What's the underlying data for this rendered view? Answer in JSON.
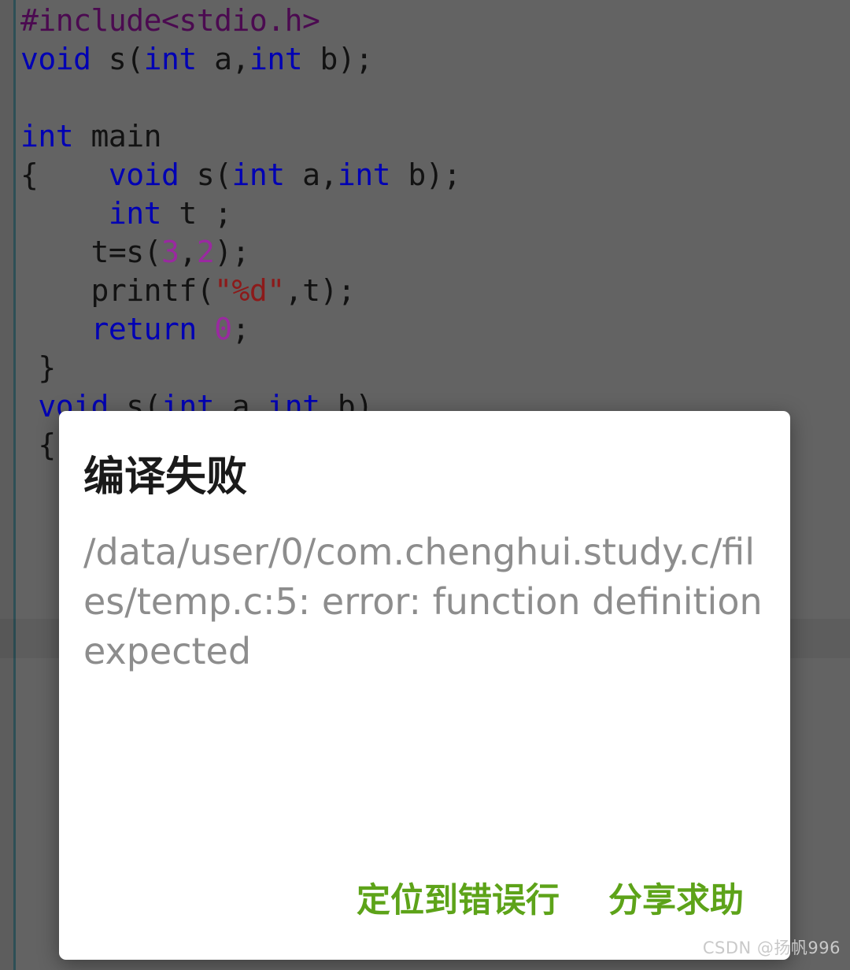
{
  "editor": {
    "language": "c",
    "code_lines": [
      [
        {
          "t": "#include<stdio.h>",
          "c": "pre"
        }
      ],
      [
        {
          "t": "void",
          "c": "kw"
        },
        {
          "t": " s(",
          "c": "pl"
        },
        {
          "t": "int",
          "c": "kw"
        },
        {
          "t": " a,",
          "c": "pl"
        },
        {
          "t": "int",
          "c": "kw"
        },
        {
          "t": " b);",
          "c": "pl"
        }
      ],
      [],
      [
        {
          "t": "int",
          "c": "kw"
        },
        {
          "t": " main",
          "c": "pl"
        }
      ],
      [
        {
          "t": "{    ",
          "c": "pl"
        },
        {
          "t": "void",
          "c": "kw"
        },
        {
          "t": " s(",
          "c": "pl"
        },
        {
          "t": "int",
          "c": "kw"
        },
        {
          "t": " a,",
          "c": "pl"
        },
        {
          "t": "int",
          "c": "kw"
        },
        {
          "t": " b);",
          "c": "pl"
        }
      ],
      [
        {
          "t": "     ",
          "c": "pl"
        },
        {
          "t": "int",
          "c": "kw"
        },
        {
          "t": " t ;",
          "c": "pl"
        }
      ],
      [
        {
          "t": "    t=s(",
          "c": "pl"
        },
        {
          "t": "3",
          "c": "num"
        },
        {
          "t": ",",
          "c": "pl"
        },
        {
          "t": "2",
          "c": "num"
        },
        {
          "t": ");",
          "c": "pl"
        }
      ],
      [
        {
          "t": "    printf(",
          "c": "pl"
        },
        {
          "t": "\"%d\"",
          "c": "str"
        },
        {
          "t": ",t);",
          "c": "pl"
        }
      ],
      [
        {
          "t": "    ",
          "c": "pl"
        },
        {
          "t": "return",
          "c": "kw"
        },
        {
          "t": " ",
          "c": "pl"
        },
        {
          "t": "0",
          "c": "num"
        },
        {
          "t": ";",
          "c": "pl"
        }
      ],
      [
        {
          "t": " }",
          "c": "pl"
        }
      ],
      [
        {
          "t": " ",
          "c": "pl"
        },
        {
          "t": "void",
          "c": "kw"
        },
        {
          "t": " s(",
          "c": "pl"
        },
        {
          "t": "int",
          "c": "kw"
        },
        {
          "t": " a,",
          "c": "pl"
        },
        {
          "t": "int",
          "c": "kw"
        },
        {
          "t": " b)",
          "c": "pl"
        }
      ],
      [
        {
          "t": " {",
          "c": "pl"
        }
      ]
    ],
    "colors": {
      "background": "#636363",
      "gutter_rule": "#2e4f56",
      "keyword": "#0000b4",
      "preprocessor": "#4b0a50",
      "number": "#9a29a0",
      "string": "#8c1a1a",
      "plain": "#121212"
    }
  },
  "dialog": {
    "title": "编译失败",
    "message": "/data/user/0/com.chenghui.study.c/files/temp.c:5: error: function definition expected",
    "buttons": [
      {
        "label": "定位到错误行"
      },
      {
        "label": "分享求助"
      }
    ],
    "colors": {
      "surface": "#ffffff",
      "title": "#1a1a1a",
      "message": "#8d8d8d",
      "action": "#5da319"
    }
  },
  "watermark": {
    "text": "CSDN @扬帆996"
  }
}
